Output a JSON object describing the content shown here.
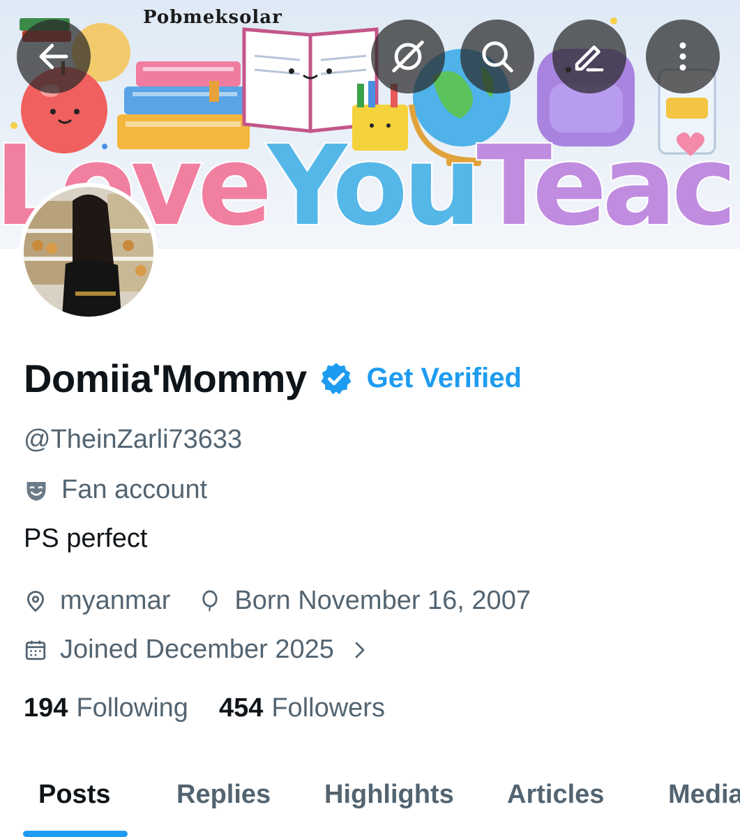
{
  "banner": {
    "watermark": "Pobmeksolar",
    "text_love": "Love",
    "text_you": "You",
    "text_teacher": "Teacher"
  },
  "nav": [
    "back-arrow-icon",
    "grok-icon",
    "search-icon",
    "edit-icon",
    "more-vertical-icon"
  ],
  "profile": {
    "display_name": "Domiia'Mommy",
    "get_verified": "Get Verified",
    "handle": "@TheinZarli73633",
    "label": "Fan account",
    "bio": "PS perfect",
    "location": "myanmar",
    "birthday": "Born November 16, 2007",
    "joined": "Joined December 2025"
  },
  "stats": {
    "following_count": "194",
    "following_label": "Following",
    "followers_count": "454",
    "followers_label": "Followers"
  },
  "tabs": [
    {
      "label": "Posts",
      "active": true
    },
    {
      "label": "Replies",
      "active": false
    },
    {
      "label": "Highlights",
      "active": false
    },
    {
      "label": "Articles",
      "active": false
    },
    {
      "label": "Media",
      "active": false
    }
  ],
  "colors": {
    "accent": "#1d9bf0",
    "secondary_text": "#536471",
    "primary_text": "#0f1419"
  }
}
